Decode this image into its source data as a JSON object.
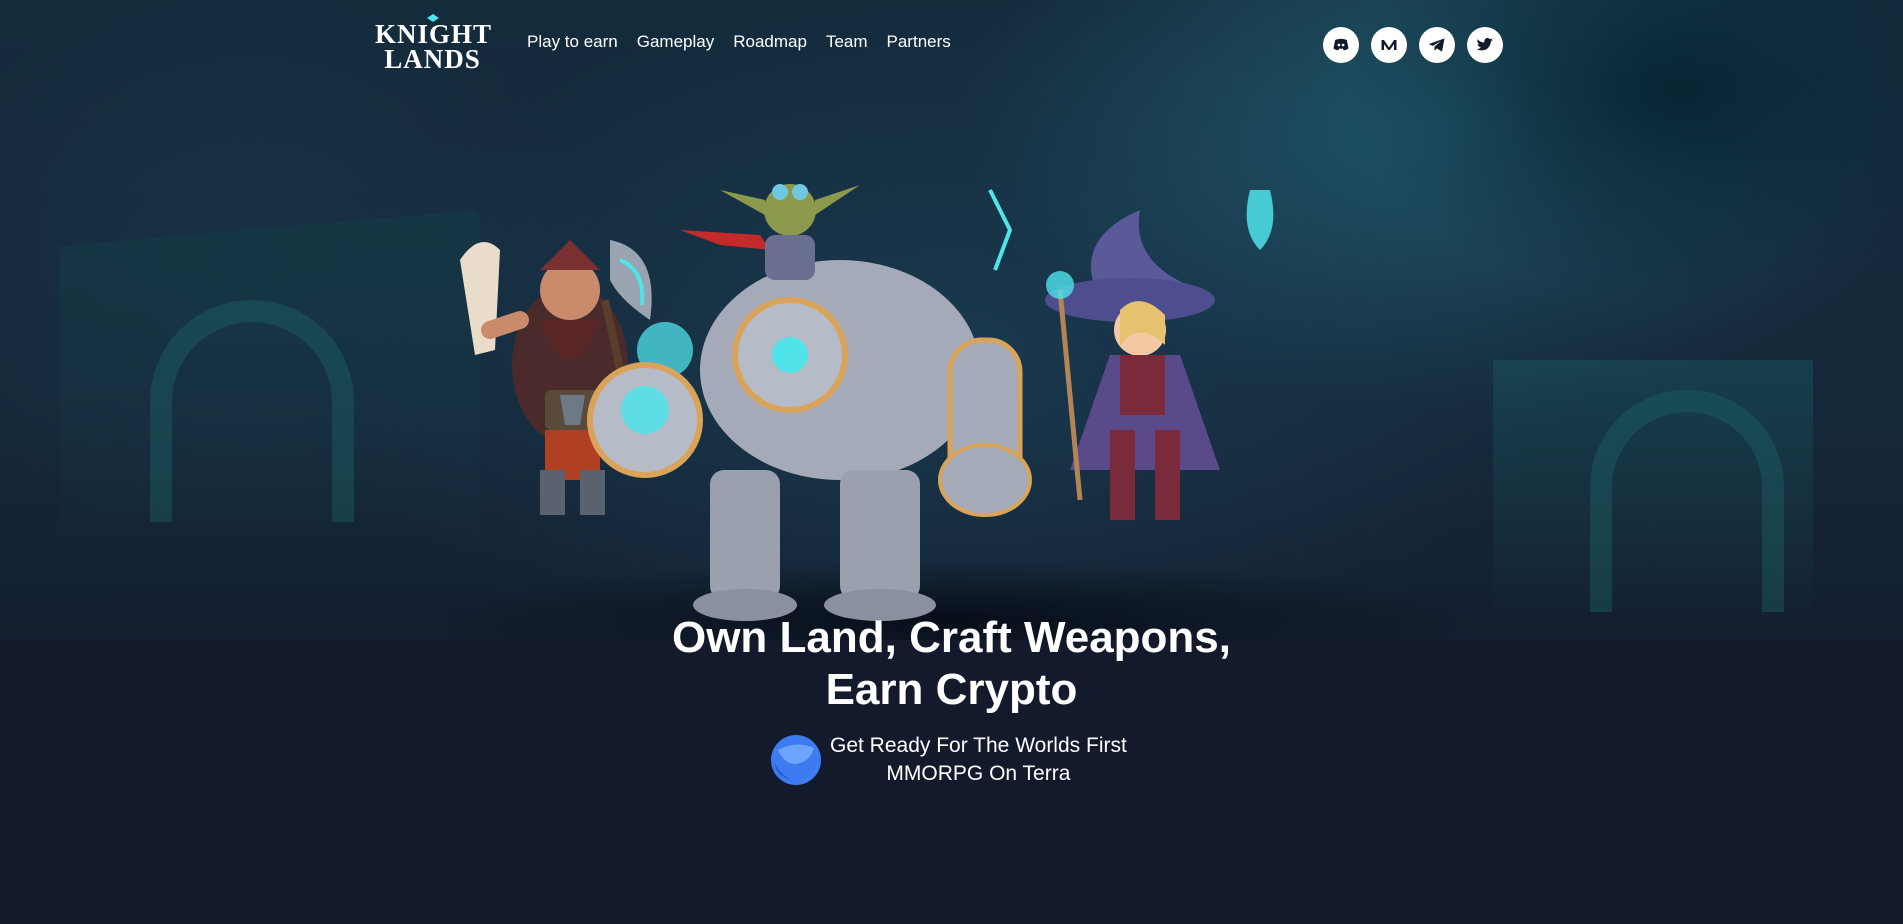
{
  "brand": {
    "line1": "KNIGHT",
    "line2": "LANDS"
  },
  "nav": {
    "items": [
      {
        "label": "Play to earn"
      },
      {
        "label": "Gameplay"
      },
      {
        "label": "Roadmap"
      },
      {
        "label": "Team"
      },
      {
        "label": "Partners"
      }
    ]
  },
  "social": {
    "icons": [
      "discord-icon",
      "medium-icon",
      "telegram-icon",
      "twitter-icon"
    ]
  },
  "hero": {
    "title_line1": "Own Land, Craft Weapons,",
    "title_line2": "Earn Crypto",
    "tagline_line1": "Get Ready For The Worlds First",
    "tagline_line2": "MMORPG On Terra"
  },
  "colors": {
    "background": "#131a2c",
    "text": "#ffffff",
    "accent_cyan": "#4fe3ea",
    "terra_blue": "#3d7cf0"
  }
}
